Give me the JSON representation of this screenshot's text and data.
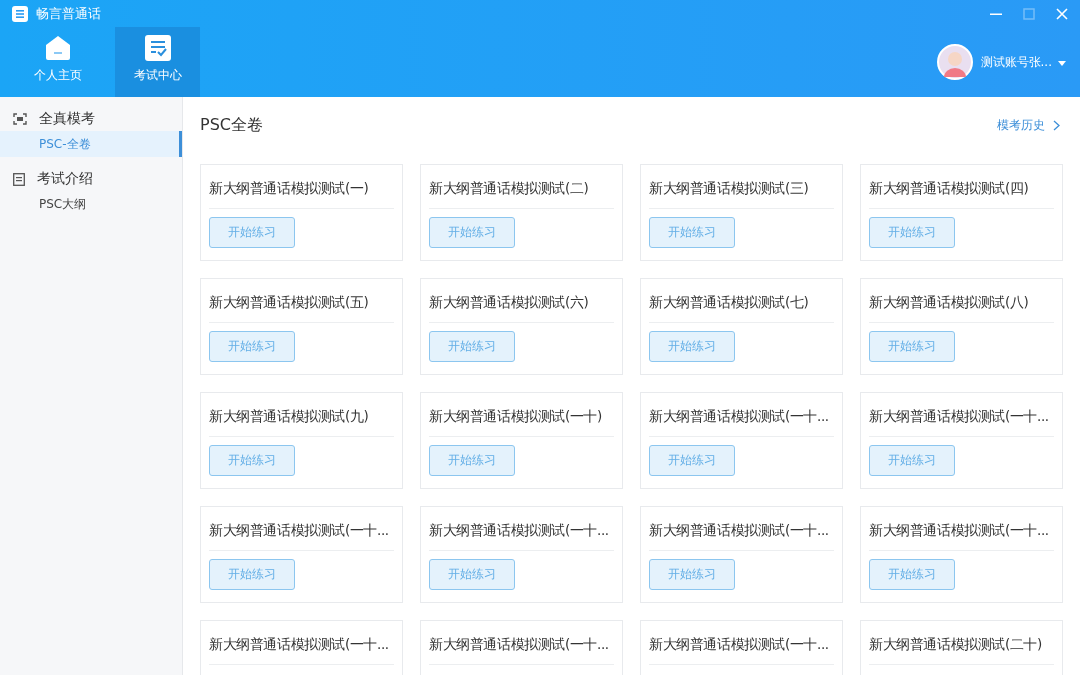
{
  "window": {
    "title": "畅言普通话",
    "controls": [
      {
        "kind": "minimize",
        "disabled": false
      },
      {
        "kind": "maximize",
        "disabled": true
      },
      {
        "kind": "close",
        "disabled": false
      }
    ]
  },
  "nav": [
    {
      "label": "个人主页",
      "kind": "home",
      "selected": false
    },
    {
      "label": "考试中心",
      "kind": "exam",
      "selected": true
    }
  ],
  "user": {
    "name": "测试账号张..."
  },
  "sidebar": [
    {
      "label": "全真模考",
      "kind": "scan",
      "children": [
        {
          "label": "PSC-全卷",
          "selected": true
        }
      ]
    },
    {
      "label": "考试介绍",
      "kind": "doc",
      "children": [
        {
          "label": "PSC大纲",
          "selected": false
        }
      ]
    }
  ],
  "page": {
    "title": "PSC全卷",
    "history_link": "模考历史"
  },
  "cards": [
    {
      "title": "新大纲普通话模拟测试(一)",
      "button": "开始练习"
    },
    {
      "title": "新大纲普通话模拟测试(二)",
      "button": "开始练习"
    },
    {
      "title": "新大纲普通话模拟测试(三)",
      "button": "开始练习"
    },
    {
      "title": "新大纲普通话模拟测试(四)",
      "button": "开始练习"
    },
    {
      "title": "新大纲普通话模拟测试(五)",
      "button": "开始练习"
    },
    {
      "title": "新大纲普通话模拟测试(六)",
      "button": "开始练习"
    },
    {
      "title": "新大纲普通话模拟测试(七)",
      "button": "开始练习"
    },
    {
      "title": "新大纲普通话模拟测试(八)",
      "button": "开始练习"
    },
    {
      "title": "新大纲普通话模拟测试(九)",
      "button": "开始练习"
    },
    {
      "title": "新大纲普通话模拟测试(一十)",
      "button": "开始练习"
    },
    {
      "title": "新大纲普通话模拟测试(一十...",
      "button": "开始练习"
    },
    {
      "title": "新大纲普通话模拟测试(一十...",
      "button": "开始练习"
    },
    {
      "title": "新大纲普通话模拟测试(一十...",
      "button": "开始练习"
    },
    {
      "title": "新大纲普通话模拟测试(一十...",
      "button": "开始练习"
    },
    {
      "title": "新大纲普通话模拟测试(一十...",
      "button": "开始练习"
    },
    {
      "title": "新大纲普通话模拟测试(一十...",
      "button": "开始练习"
    },
    {
      "title": "新大纲普通话模拟测试(一十..."
    },
    {
      "title": "新大纲普通话模拟测试(一十..."
    },
    {
      "title": "新大纲普通话模拟测试(一十..."
    },
    {
      "title": "新大纲普通话模拟测试(二十)"
    }
  ]
}
